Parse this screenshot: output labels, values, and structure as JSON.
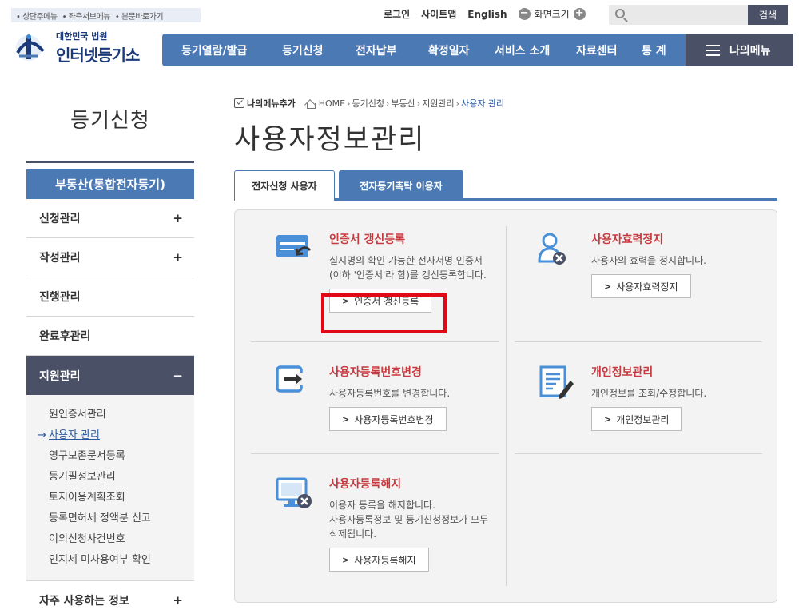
{
  "skip_links": [
    "상단주메뉴",
    "좌측서브메뉴",
    "본문바로가기"
  ],
  "util": {
    "login": "로그인",
    "sitemap": "사이트맵",
    "english": "English",
    "zoom_label": "화면크기",
    "zoom_minus": "−",
    "zoom_plus": "+"
  },
  "search": {
    "placeholder": "",
    "button": "검색"
  },
  "logo": {
    "line1": "대한민국 법원",
    "line2": "인터넷등기소"
  },
  "nav": {
    "items": [
      "등기열람/발급",
      "등기신청",
      "전자납부",
      "확정일자",
      "서비스 소개",
      "자료센터",
      "통 계"
    ],
    "mymenu": "나의메뉴"
  },
  "sidebar": {
    "title": "등기신청",
    "head": "부동산(통합전자등기)",
    "items": [
      {
        "label": "신청관리",
        "mark": "+"
      },
      {
        "label": "작성관리",
        "mark": "+"
      },
      {
        "label": "진행관리",
        "mark": ""
      },
      {
        "label": "완료후관리",
        "mark": ""
      },
      {
        "label": "지원관리",
        "mark": "−"
      }
    ],
    "sub": [
      "원인증서관리",
      "사용자 관리",
      "영구보존문서등록",
      "등기필정보관리",
      "토지이용계획조회",
      "등록면허세 정액분 신고",
      "이의신청사건번호",
      "인지세 미사용여부 확인"
    ],
    "sub_current_arrow": "→",
    "last": {
      "label": "자주 사용하는 정보",
      "mark": "+"
    }
  },
  "breadcrumb": {
    "add": "나의메뉴추가",
    "items": [
      "HOME",
      "등기신청",
      "부동산",
      "지원관리",
      "사용자 관리"
    ],
    "sep": "›"
  },
  "page_title": "사용자정보관리",
  "tabs": [
    "전자신청 사용자",
    "전자등기촉탁 이용자"
  ],
  "cards": {
    "cert": {
      "title": "인증서 갱신등록",
      "desc": "실지명의 확인 가능한 전자서명 인증서(이하 '인증서'라 함)를 갱신등록합니다.",
      "button": "인증서 갱신등록"
    },
    "suspend": {
      "title": "사용자효력정지",
      "desc": "사용자의 효력을 정지합니다.",
      "button": "사용자효력정지"
    },
    "regno": {
      "title": "사용자등록번호변경",
      "desc": "사용자등록번호를 변경합니다.",
      "button": "사용자등록번호변경"
    },
    "privacy": {
      "title": "개인정보관리",
      "desc": "개인정보를 조회/수정합니다.",
      "button": "개인정보관리"
    },
    "cancel": {
      "title": "사용자등록해지",
      "desc": "이용자 등록을 해지합니다.\n사용자등록정보 및 등기신청정보가 모두 삭제됩니다.",
      "button": "사용자등록해지"
    }
  },
  "button_arrow": ">",
  "colors": {
    "nav": "#4a79b4",
    "dark": "#4a5166",
    "card_title": "#c8393f",
    "highlight": "#e00a17",
    "link": "#2c5aa0"
  }
}
